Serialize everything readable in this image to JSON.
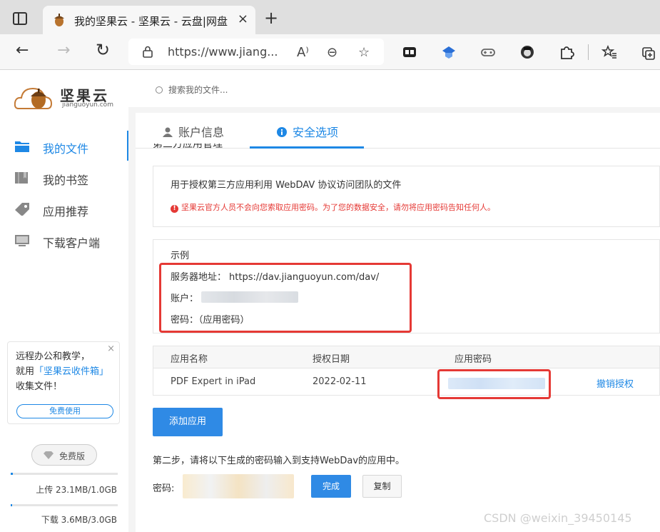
{
  "browser": {
    "tab_title": "我的坚果云 - 坚果云 - 云盘|网盘",
    "tab_close": "×",
    "new_tab": "+",
    "back": "←",
    "forward": "→",
    "reload": "↻",
    "url": "https://www.jiang...",
    "read_aloud_icon": "A⁾",
    "zoom_icon": "⊖",
    "favorite_icon": "☆"
  },
  "sidebar": {
    "logo_name": "坚果云",
    "logo_url": "jianguoyun.com",
    "items": [
      {
        "label": "我的文件",
        "icon": "folder-icon",
        "active": true
      },
      {
        "label": "我的书签",
        "icon": "bookmark-icon",
        "active": false
      },
      {
        "label": "应用推荐",
        "icon": "tag-icon",
        "active": false
      },
      {
        "label": "下载客户端",
        "icon": "monitor-icon",
        "active": false
      }
    ],
    "promo": {
      "line1": "远程办公和教学，",
      "line2_prefix": "就用",
      "line2_link": "「坚果云收件箱」",
      "line3": "收集文件！",
      "button": "免费使用",
      "close": "×"
    },
    "plan": "免费版",
    "upload": {
      "label": "上传 23.1MB/1.0GB",
      "fraction": 0.023
    },
    "download": {
      "label": "下载 3.6MB/3.0GB",
      "fraction": 0.001
    }
  },
  "header": {
    "search_placeholder": "搜索我的文件..."
  },
  "settings": {
    "tabs": [
      {
        "label": "账户信息",
        "active": false
      },
      {
        "label": "安全选项",
        "active": true
      }
    ],
    "clipped_heading": "第三方应用管理",
    "description": "用于授权第三方应用利用 WebDAV 协议访问团队的文件",
    "warning": "坚果云官方人员不会向您索取应用密码。为了您的数据安全，请勿将应用密码告知任何人。",
    "example": {
      "title": "示例",
      "server_label": "服务器地址：",
      "server_value": "https://dav.jianguoyun.com/dav/",
      "account_label": "账户：",
      "password_label": "密码：",
      "password_value": "（应用密码）"
    },
    "table": {
      "headers": [
        "应用名称",
        "授权日期",
        "应用密码"
      ],
      "rows": [
        {
          "name": "PDF Expert in iPad",
          "date": "2022-02-11",
          "action": "撤销授权"
        }
      ]
    },
    "add_app_button": "添加应用",
    "step2": "第二步，请将以下生成的密码输入到支持WebDav的应用中。",
    "password_label": "密码:",
    "done_button": "完成",
    "copy_button": "复制"
  },
  "watermark": "CSDN @weixin_39450145",
  "colors": {
    "accent": "#1e88e5",
    "warning": "#e53935",
    "highlight": "#e53935"
  }
}
